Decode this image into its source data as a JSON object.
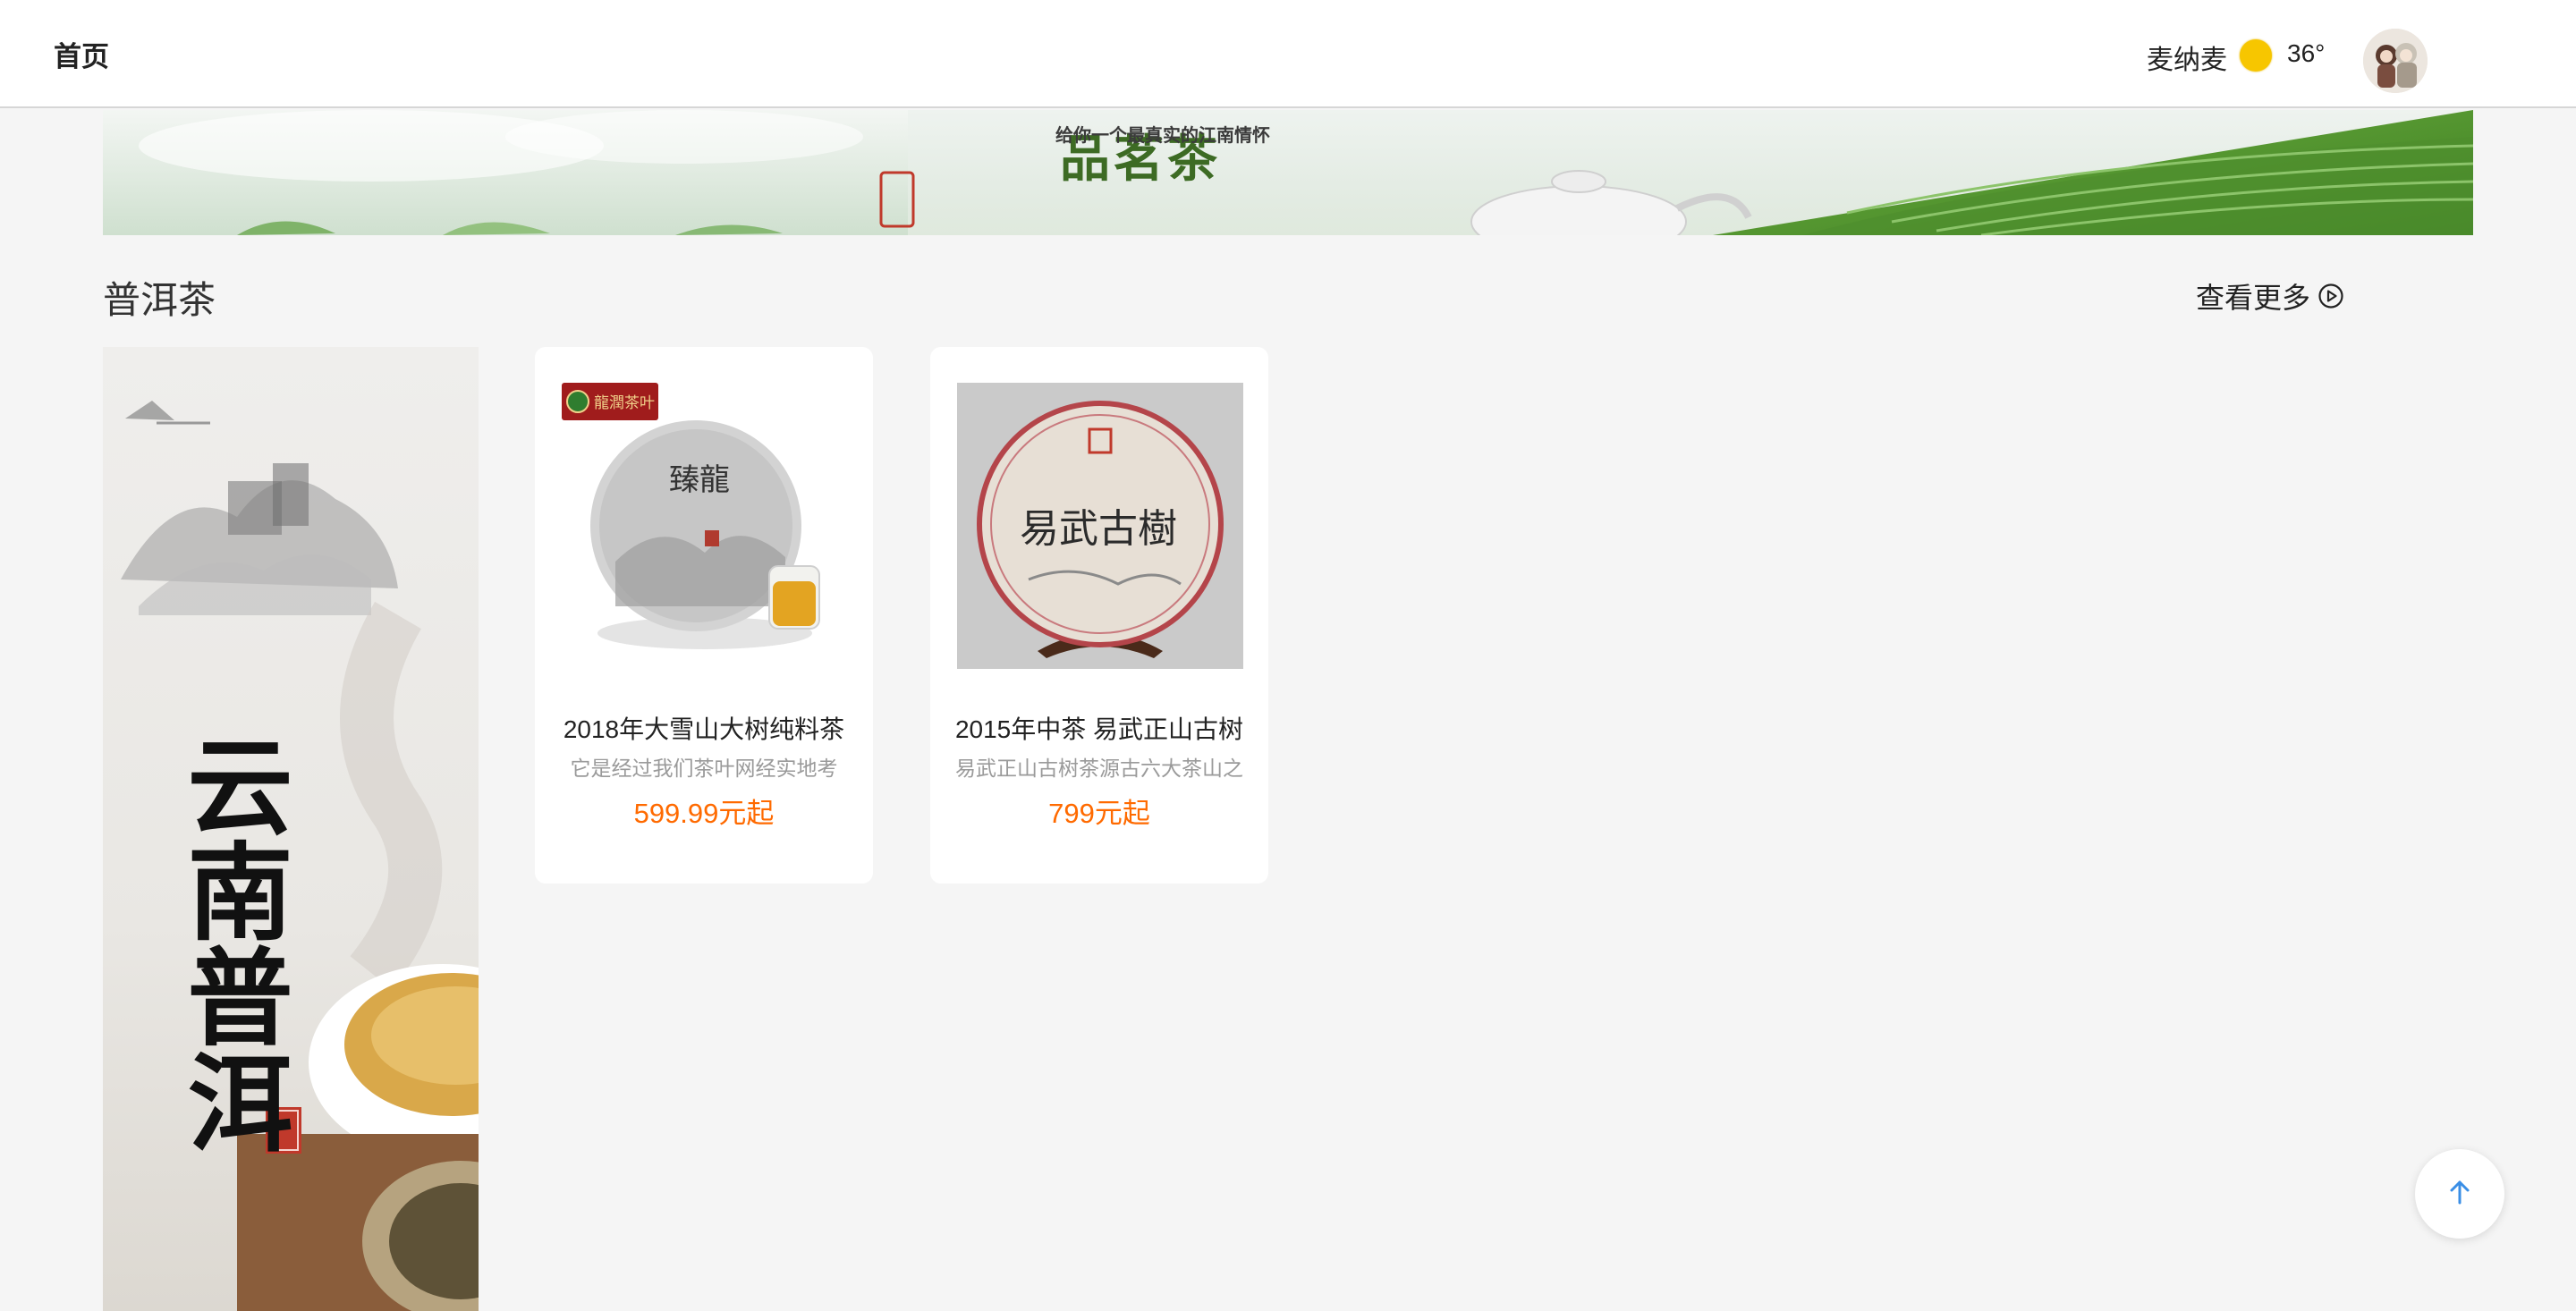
{
  "header": {
    "home_label": "首页",
    "user_name": "麦纳麦",
    "weather_icon": "sun-icon",
    "temperature": "36°"
  },
  "banner": {
    "title": "品茗茶",
    "slogan": "给你一个最真实的江南情怀"
  },
  "section": {
    "title": "普洱茶",
    "more_label": "查看更多"
  },
  "poster": {
    "calligraphy": "云南普洱"
  },
  "products": [
    {
      "name": "2018年大雪山大树纯料茶",
      "description": "它是经过我们茶叶网经实地考",
      "price": "599.99元起",
      "logo_text": "龍潤茶叶",
      "cake_text": "臻龍"
    },
    {
      "name": "2015年中茶 易武正山古树",
      "description": "易武正山古树茶源古六大茶山之",
      "price": "799元起",
      "cake_text": "易武古樹"
    }
  ],
  "colors": {
    "price": "#ff6a00",
    "accent_blue": "#3a8ee6",
    "sun": "#f7c600"
  }
}
